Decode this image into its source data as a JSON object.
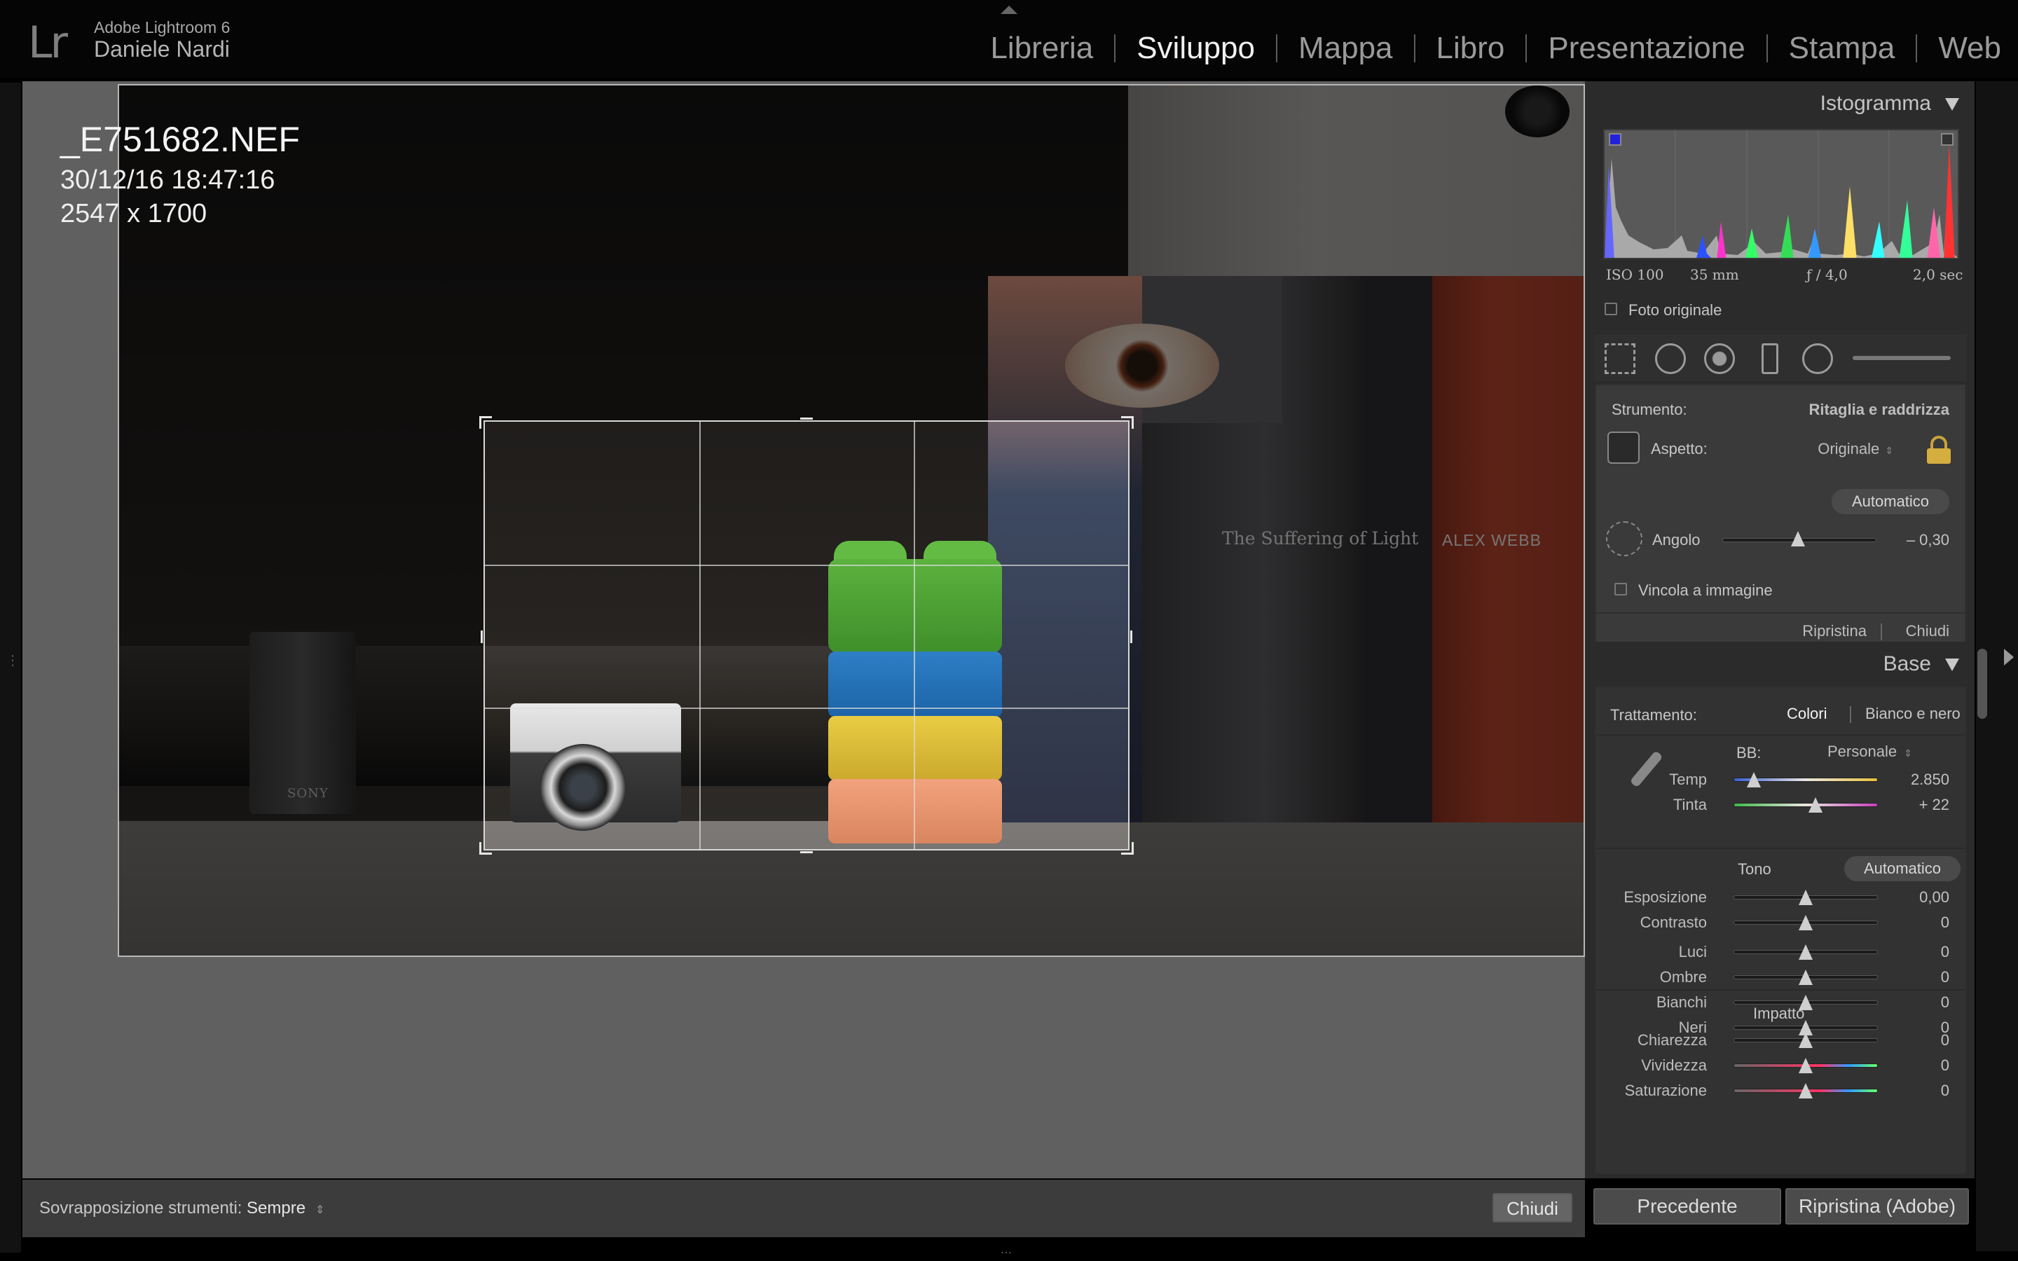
{
  "app": {
    "logo": "Lr",
    "product": "Adobe Lightroom 6",
    "user": "Daniele Nardi"
  },
  "modules": [
    {
      "label": "Libreria",
      "active": false
    },
    {
      "label": "Sviluppo",
      "active": true
    },
    {
      "label": "Mappa",
      "active": false
    },
    {
      "label": "Libro",
      "active": false
    },
    {
      "label": "Presentazione",
      "active": false
    },
    {
      "label": "Stampa",
      "active": false
    },
    {
      "label": "Web",
      "active": false
    }
  ],
  "photo_info": {
    "filename": "_E751682.NEF",
    "datetime": "30/12/16 18:47:16",
    "dimensions": "2547 x 1700"
  },
  "photo_text": {
    "speaker_brand": "SONY",
    "book_title": "The Suffering of Light",
    "book_author": "ALEX WEBB"
  },
  "histogram": {
    "title": "Istogramma",
    "iso": "ISO 100",
    "focal": "35 mm",
    "aperture": "ƒ / 4,0",
    "shutter": "2,0 sec",
    "original_photo": "Foto originale"
  },
  "crop_panel": {
    "tool_label": "Strumento:",
    "tool_value": "Ritaglia e raddrizza",
    "aspect_label": "Aspetto:",
    "aspect_value": "Originale",
    "auto_button": "Automatico",
    "angle_label": "Angolo",
    "angle_value": "– 0,30",
    "angle_position": 0.49,
    "constrain_label": "Vincola a immagine",
    "reset_button": "Ripristina",
    "close_button": "Chiudi"
  },
  "base_panel": {
    "title": "Base",
    "treatment_label": "Trattamento:",
    "treatment_color": "Colori",
    "treatment_bw": "Bianco e nero",
    "wb_label": "BB:",
    "wb_value": "Personale",
    "temp": {
      "label": "Temp",
      "value": "2.850",
      "position": 0.14
    },
    "tint": {
      "label": "Tinta",
      "value": "+ 22",
      "position": 0.57
    },
    "tone_label": "Tono",
    "tone_auto": "Automatico",
    "tone_sliders": [
      {
        "label": "Esposizione",
        "value": "0,00",
        "position": 0.5
      },
      {
        "label": "Contrasto",
        "value": "0",
        "position": 0.5
      }
    ],
    "light_sliders": [
      {
        "label": "Luci",
        "value": "0",
        "position": 0.5
      },
      {
        "label": "Ombre",
        "value": "0",
        "position": 0.5
      },
      {
        "label": "Bianchi",
        "value": "0",
        "position": 0.5
      },
      {
        "label": "Neri",
        "value": "0",
        "position": 0.5
      }
    ],
    "impact_label": "Impatto",
    "impact_sliders": [
      {
        "label": "Chiarezza",
        "value": "0",
        "position": 0.5
      },
      {
        "label": "Vividezza",
        "value": "0",
        "position": 0.5
      },
      {
        "label": "Saturazione",
        "value": "0",
        "position": 0.5
      }
    ]
  },
  "toolbar": {
    "overlay_label": "Sovrapposizione strumenti:",
    "overlay_value": "Sempre",
    "close_button": "Chiudi"
  },
  "panel_buttons": {
    "previous": "Precedente",
    "reset": "Ripristina (Adobe)"
  },
  "colors": {
    "background": "#606060",
    "panel": "#2b2b2b",
    "active_module": "#f0f0f0"
  }
}
